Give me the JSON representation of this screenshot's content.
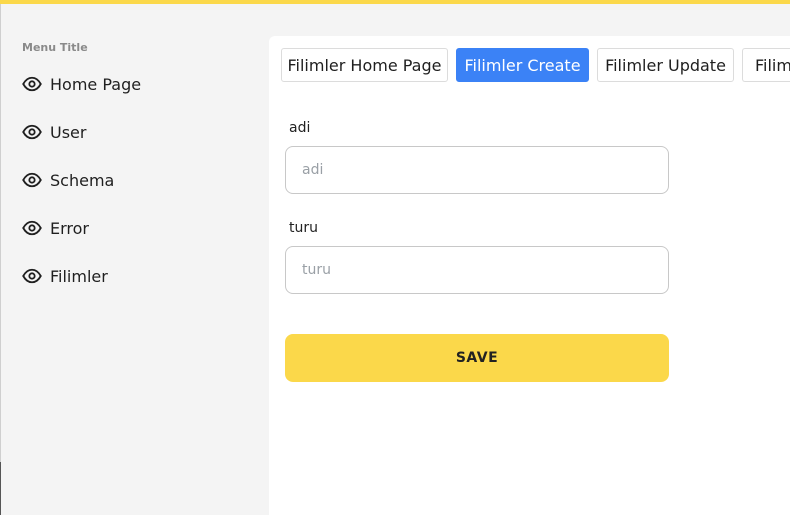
{
  "sidebar": {
    "title": "Menu Title",
    "items": [
      {
        "label": "Home Page",
        "icon": "eye-icon"
      },
      {
        "label": "User",
        "icon": "eye-icon"
      },
      {
        "label": "Schema",
        "icon": "eye-icon"
      },
      {
        "label": "Error",
        "icon": "eye-icon"
      },
      {
        "label": "Filimler",
        "icon": "eye-icon"
      }
    ]
  },
  "tabs": [
    {
      "label": "Filimler Home Page",
      "active": false
    },
    {
      "label": "Filimler Create",
      "active": true
    },
    {
      "label": "Filimler Update",
      "active": false
    },
    {
      "label": "Filimler Delete",
      "active": false
    }
  ],
  "form": {
    "fields": [
      {
        "label": "adi",
        "placeholder": "adi",
        "value": ""
      },
      {
        "label": "turu",
        "placeholder": "turu",
        "value": ""
      }
    ],
    "save_label": "SAVE"
  },
  "colors": {
    "accent": "#fbd84a",
    "active_tab": "#3b82f6",
    "background": "#f4f4f4"
  }
}
